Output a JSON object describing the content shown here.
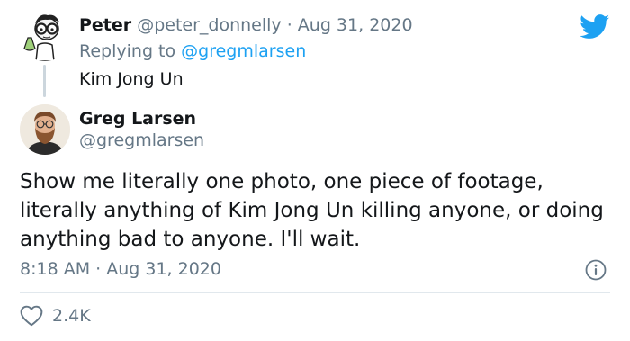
{
  "reply": {
    "display_name": "Peter",
    "handle": "@peter_donnelly",
    "separator": " · ",
    "date": "Aug 31, 2020",
    "replying_prefix": "Replying to ",
    "replying_to": "@gregmlarsen",
    "text": "Kim Jong Un"
  },
  "tweet": {
    "display_name": "Greg Larsen",
    "handle": "@gregmlarsen",
    "text": "Show me literally one photo, one piece of footage, literally anything of Kim Jong Un killing anyone, or doing anything bad to anyone. I'll wait.",
    "timestamp": "8:18 AM · Aug 31, 2020",
    "like_count": "2.4K"
  },
  "colors": {
    "twitter_blue": "#1da1f2",
    "muted_text": "#657786",
    "primary_text": "#14171a"
  },
  "icons": {
    "logo": "twitter-bird-icon",
    "info": "info-icon",
    "like": "heart-icon"
  }
}
